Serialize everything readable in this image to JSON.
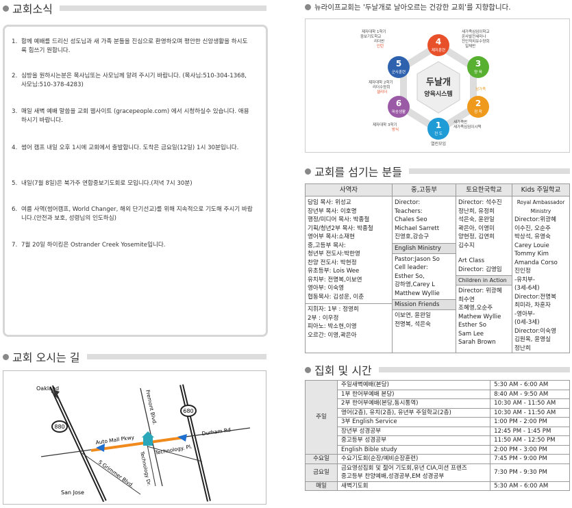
{
  "news": {
    "title": "교회소식",
    "items": [
      {
        "num": "1.",
        "text": "함께 예배를 드리신 성도님과 새 가족 분들을 진심으로 환영하오며 평안한 신앙생활을 하시도록 힘쓰기 원합니다."
      },
      {
        "num": "2.",
        "text": "심방을 원하시는분은 목사님또는 사모님께 알려 주시기 바랍니다. (목사님:510-304-1368, 사모님:510-378-4283)"
      },
      {
        "num": "3.",
        "text": "매일 새벽 예배 말씀을 교회 웹사이트 (gracepeople.com) 에서 시청하실수 있습니다. 애용하시기 바랍니다."
      },
      {
        "num": "4.",
        "text": "썸어 캠프 내일 오후 1시에 교회에서 출발합니다. 도착은 금요일(12일) 1시 30분입니다."
      },
      {
        "num": "5.",
        "text": "내일(7월 8일)은 북가주 연합중보기도회로 모입니다.(저녁 7시 30분)"
      },
      {
        "num": "6.",
        "text": "여름 사역(썸어캠프, World Changer, 해외 단기선교)를 위해 지속적으로 기도해 주시기 바랍니다.(안전과 보호, 성령님의 인도하심)"
      },
      {
        "num": "7.",
        "text": "7월 20일 하이킹은 Ostrander Creek Yosemite입니다."
      }
    ]
  },
  "vision": {
    "title": "뉴라이프교회는 '두날개로 날아오르는 건강한 교회'를 지향합니다.",
    "center_1": "두날개",
    "center_2": "양육시스템",
    "nodes": [
      {
        "num": "1",
        "label": "전 도",
        "color": "#1f9bd6"
      },
      {
        "num": "2",
        "label": "정 착",
        "color": "#ef9a1c"
      },
      {
        "num": "3",
        "label": "양 육",
        "color": "#58b030"
      },
      {
        "num": "4",
        "label": "제자훈련",
        "color": "#e8502a"
      },
      {
        "num": "5",
        "label": "군사훈련",
        "color": "#2f62ae"
      },
      {
        "num": "6",
        "label": "파송생활",
        "color": "#9a5aa6"
      }
    ],
    "notes": {
      "top_left_1": "제자대학 1학기",
      "top_left_2": "중보기도학교",
      "top_left_3": "리더반",
      "top_left_4": "인턴",
      "top_right_1": "새가족심임이학교",
      "top_right_2": "온사발전세미나",
      "top_right_3": "전인적치유수양회",
      "top_right_4": "일체반",
      "right_mid": "성가족",
      "left_mid_1": "제자대학 2학기",
      "left_mid_2": "리더수양회",
      "left_mid_3": "셀리더",
      "bottom_left_1": "제자대학 3학기",
      "bottom_left_2": "방식",
      "bottom_right_1": "새가족반",
      "bottom_right_2": "새가족심임이시택",
      "bottom": "열린모임"
    }
  },
  "directions": {
    "title": "교회 오시는 길",
    "labels": {
      "oakland": "Oakland",
      "san_jose": "San Jose",
      "i880": "880",
      "i680": "680",
      "fremont": "Fremont Blvd.",
      "auto_mall": "Auto Mall Pkwy",
      "durham": "Durham Rd",
      "technology_dr": "Technology Dr.",
      "technology_pl": "Technology. Pl.",
      "grimmer": "S Grimmer Blvd."
    }
  },
  "staff": {
    "title": "교회를 섬기는 분들",
    "headers": [
      "사역자",
      "중,고등부",
      "토요한국학교",
      "Kids 주일학교"
    ],
    "col1": [
      "담임 목사: 위성교",
      "장년부 목사: 이호명",
      "행정/미디어 목사: 박종철",
      "기획/청년2부 목사: 박종철",
      "영어부 목사:소재현",
      "중,고등부 목사:",
      "청년부 전도사:박한영",
      "찬양 전도사: 박현정",
      "유초등부: Lois Wee",
      "유치부: 전명복,이보연",
      "영아부: 이숙영",
      "협동목사: 김성운, 이춘"
    ],
    "col1b": [
      "지휘자: 1부 : 정영희",
      "           2부 : 이우정",
      "피아노: 박소현,이영",
      "오르간: 이영,곽은아"
    ],
    "col2a": [
      "Director:",
      "Teachers:",
      "  Chales Seo",
      "  Michael Sarrett",
      "  진영호,강승구"
    ],
    "col2_sub1": "English Ministry",
    "col2b": [
      "Pastor:Jason So",
      "Cell leader:",
      "  Esther So,",
      "  강하영,Carey L",
      "  Matthew Wyllie"
    ],
    "col2_sub2": "Mission Friends",
    "col2c": [
      "이보연, 윤완일",
      "전명복, 석은숙"
    ],
    "col3a": [
      "Director: 석수진",
      "정난희, 유정희",
      "석은숙, 윤완일",
      "곽은아, 이영미",
      "양현정, 김연희",
      "김수지"
    ],
    "col3b": [
      "Art Class",
      "Director: 김영임"
    ],
    "col3_sub": "Children in Action",
    "col3c": [
      "Director: 위광혜",
      "최수연",
      "조혜영,오순주",
      "Mathew Wyllie",
      "Esther So",
      "Sam Lee",
      "Sarah Brown"
    ],
    "col4a": [
      "Royal Ambassador",
      "Ministry"
    ],
    "col4b": [
      "Director:위광혜",
      "이수진, 오순주",
      "박상석, 유영숙",
      "Carey Louie",
      "Tommy Kim",
      "Amanda Corso",
      "진인정",
      "  -유치부-",
      "  (3세-6세)",
      "Director:전명복",
      "최미라, 차훈자",
      "  -영아부-",
      "  (0세-3세)",
      "Director:이숙영",
      "김원옥, 윤영실",
      "정난희"
    ]
  },
  "schedule": {
    "title": "집회 및 시간",
    "sunday_label": "주일",
    "sunday": [
      {
        "name": "주일새벽예배(본당)",
        "time": "5:30 AM - 6:00 AM"
      },
      {
        "name": "1부 한어부예배 본당)",
        "time": "8:40 AM - 9:50 AM"
      },
      {
        "name": "2부 한어부예배(본당,동시통역)",
        "time": "10:30 AM - 11:50 AM"
      },
      {
        "name": "영어(2층), 유치(2층), 유년부 주일학교(2층)",
        "time": "10:30 AM - 11:50 AM"
      },
      {
        "name": "3부 English Service",
        "time": "1:00 PM - 2:00 PM"
      },
      {
        "name": "장년부 성경공부",
        "time": "12:45 PM - 1:45 PM"
      },
      {
        "name": "중고등부 성경공부",
        "time": "11:50 AM - 12:50 PM"
      },
      {
        "name": "English Bible study",
        "time": "2:00 PM -  3:00 PM"
      }
    ],
    "wed_label": "수요일",
    "wed": {
      "name": "수요기도회(순장/예비순장훈련)",
      "time": "7:45 PM - 9:00 PM"
    },
    "fri_label": "금요일",
    "fri_name_1": "금요영성집회 및 젊어 기도회,유년 CIA,미션 프렌즈",
    "fri_name_2": "중고등부 찬양예배,성경공부,EM 성경공부",
    "fri_time": "7:30 PM - 9:30 PM",
    "daily_label": "매일",
    "daily": {
      "name": "새벽기도회",
      "time": "5:30 AM - 6:00 AM"
    }
  }
}
